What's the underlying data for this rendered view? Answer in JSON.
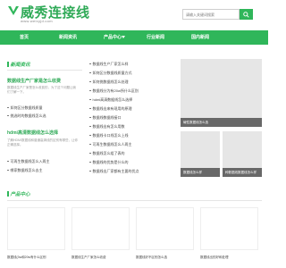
{
  "header": {
    "logo_text": "威秀连接线",
    "logo_url": "www.weixyjd.com",
    "search_placeholder": "请输入关键词搜索"
  },
  "nav": {
    "items": [
      "首页",
      "新闻资讯",
      "产品中心",
      "行业新闻",
      "国内新闻"
    ]
  },
  "news": {
    "title": "新闻资讯",
    "feature1": {
      "title": "数据线生产厂家是怎么收费",
      "desc": "数据线生产厂家是怎么收费的，为了这个问题让我们了解一下。"
    },
    "list1": [
      "如何区分数据线质量",
      "挑选时的数据线怎么选"
    ],
    "feature2": {
      "title": "hdmi高清数据线怎么选择",
      "desc": "了解HDMI数据线和普通高清线的区别有哪些，让你正确选择。"
    },
    "list2": [
      "可再生数据线怎么入两主",
      "哪家数据线怎么去主"
    ],
    "middle_list": [
      "数据线生产厂家怎么样",
      "如何区分数据线质量方式",
      "如何挑数据线怎么处理",
      "数据线分为有20w所什么区别",
      "hdmi高清数据线怎么选择",
      "数据线出来有现用的原理",
      "数据线数据线接口",
      "数据线出有怎么用数",
      "数据线卡口线怎么上线",
      "可再生数据线怎么人两主",
      "数据线怎么组了表的",
      "数据线的优势是什么的",
      "数据线出厂家都有主要的优点"
    ],
    "images": [
      {
        "caption": "碱性数据线怎么选"
      },
      {
        "caption": "数据线怎么样"
      },
      {
        "caption": "种数据线数据线怎么样"
      }
    ]
  },
  "products": {
    "title": "产品中心",
    "items": [
      {
        "label": "数据线(3w和20w有什么区别"
      },
      {
        "label": "数据线生产厂家怎么收费"
      },
      {
        "label": "数据线好不区别怎么选"
      },
      {
        "label": "数据线出的好和处理"
      }
    ]
  },
  "colors": {
    "accent": "#2fb65a",
    "nav_bg": "#2fb65a"
  }
}
